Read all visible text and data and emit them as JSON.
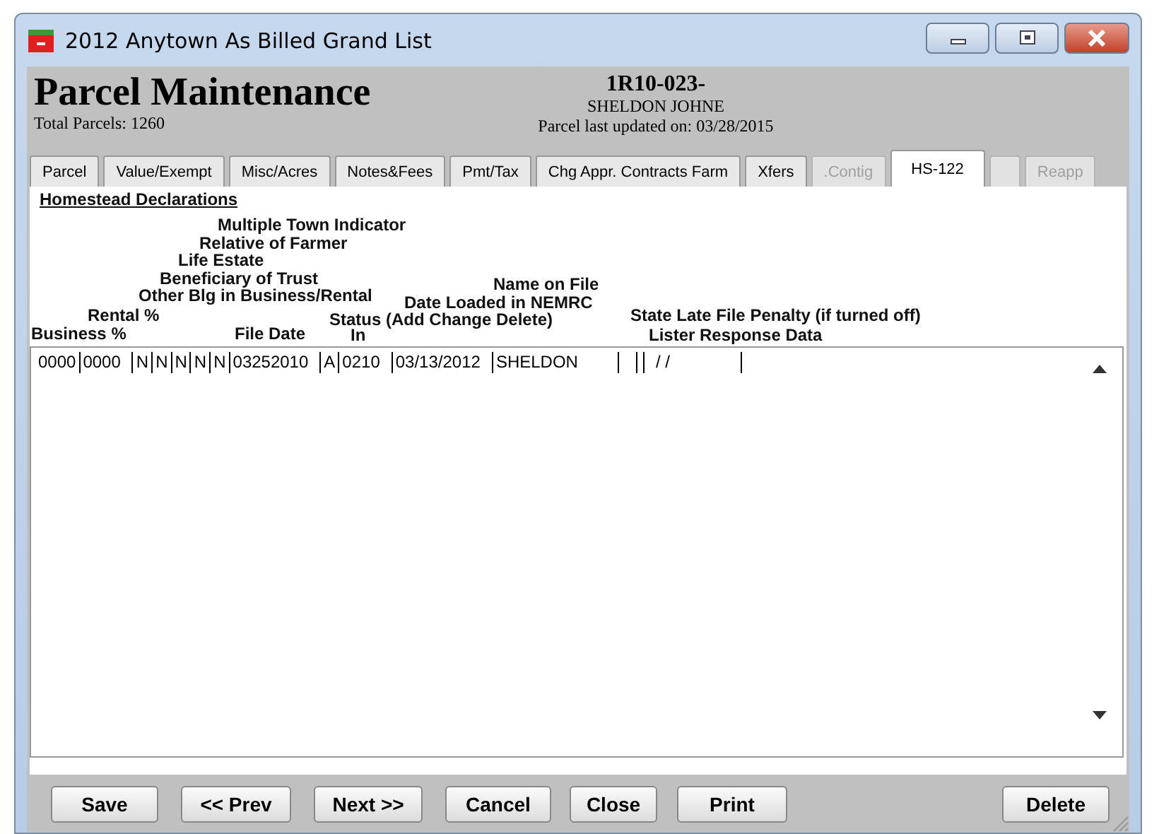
{
  "window": {
    "title": "2012 Anytown As Billed Grand List"
  },
  "header": {
    "title": "Parcel Maintenance",
    "total": "Total Parcels: 1260",
    "parcel_id": "1R10-023-",
    "owner": "SHELDON JOHNE",
    "updated": "Parcel last updated on: 03/28/2015"
  },
  "tabs": [
    {
      "label": "Parcel",
      "selected": false,
      "disabled": false
    },
    {
      "label": "Value/Exempt",
      "selected": false,
      "disabled": false
    },
    {
      "label": "Misc/Acres",
      "selected": false,
      "disabled": false
    },
    {
      "label": "Notes&Fees",
      "selected": false,
      "disabled": false
    },
    {
      "label": "Pmt/Tax",
      "selected": false,
      "disabled": false
    },
    {
      "label": "Chg Appr. Contracts Farm",
      "selected": false,
      "disabled": false
    },
    {
      "label": "Xfers",
      "selected": false,
      "disabled": false
    },
    {
      "label": ".Contig",
      "selected": false,
      "disabled": true
    },
    {
      "label": "HS-122",
      "selected": true,
      "disabled": false
    },
    {
      "selected": false,
      "disabled": true
    },
    {
      "label": "Reapp",
      "selected": false,
      "disabled": true
    }
  ],
  "section_title": "Homestead Declarations",
  "column_labels": [
    "Multiple Town Indicator",
    "Relative of Farmer",
    "Life Estate",
    "Beneficiary of Trust",
    "Name on File",
    "Other Blg in Business/Rental",
    "Date Loaded in NEMRC",
    "Rental %",
    "Status (Add Change Delete)",
    "State Late File Penalty (if turned off)",
    "Business %",
    "File Date",
    "In",
    "Lister Response Data"
  ],
  "rows": [
    [
      {
        "text": "0000"
      },
      {
        "text": "0000"
      },
      {
        "text": "N"
      },
      {
        "text": "N"
      },
      {
        "text": "N"
      },
      {
        "text": "N"
      },
      {
        "text": "N"
      },
      {
        "text": "03252010"
      },
      {
        "text": "A"
      },
      {
        "text": "0210"
      },
      {
        "text": "03/13/2012"
      },
      {
        "text": "SHELDON"
      },
      {},
      {},
      {
        "text": "/ /"
      }
    ]
  ],
  "buttons": [
    "Save",
    "<< Prev",
    "Next >>",
    "Cancel",
    "Close",
    "Print",
    "Delete"
  ]
}
